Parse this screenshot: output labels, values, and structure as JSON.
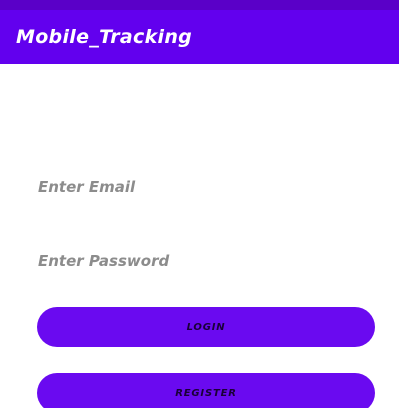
{
  "app_bar": {
    "title": "Mobile_Tracking"
  },
  "form": {
    "email_placeholder": "Enter Email",
    "email_value": "",
    "password_placeholder": "Enter Password",
    "password_value": ""
  },
  "actions": {
    "login_label": "LOGIN",
    "register_label": "REGISTER"
  },
  "colors": {
    "primary": "#6200ee",
    "button": "#6a0af0",
    "button_text": "#1a0038",
    "placeholder": "#8c8c8c"
  }
}
